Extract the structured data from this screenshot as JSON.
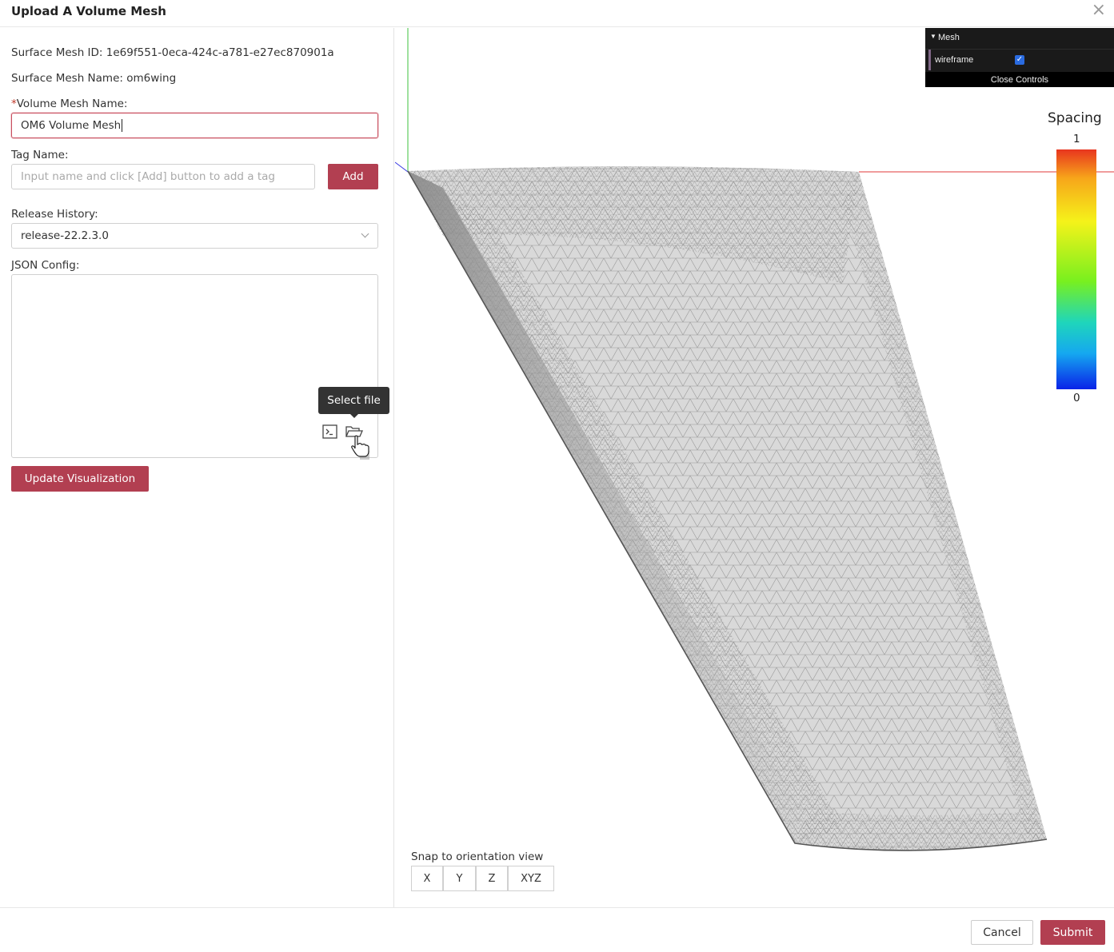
{
  "dialog": {
    "title": "Upload A Volume Mesh",
    "close_icon": "×"
  },
  "form": {
    "surface_mesh_id_label": "Surface Mesh ID:",
    "surface_mesh_id": "1e69f551-0eca-424c-a781-e27ec870901a",
    "surface_mesh_name_label": "Surface Mesh Name:",
    "surface_mesh_name": "om6wing",
    "required_mark": "*",
    "volume_mesh_name_label": "Volume Mesh Name:",
    "volume_mesh_name_value": "OM6 Volume Mesh",
    "tag_name_label": "Tag Name:",
    "tag_placeholder": "Input name and click [Add] button to add a tag",
    "add_button": "Add",
    "release_history_label": "Release History:",
    "release_history_value": "release-22.2.3.0",
    "json_config_label": "JSON Config:",
    "json_config_value": "",
    "select_file_tooltip": "Select file",
    "update_button": "Update Visualization"
  },
  "viewer": {
    "gui": {
      "folder": "Mesh",
      "wireframe_label": "wireframe",
      "wireframe_checked": true,
      "close_controls": "Close Controls"
    },
    "legend": {
      "title": "Spacing",
      "max": "1",
      "min": "0"
    },
    "snap": {
      "label": "Snap to orientation view",
      "buttons": [
        "X",
        "Y",
        "Z",
        "XYZ"
      ]
    }
  },
  "footer": {
    "cancel": "Cancel",
    "submit": "Submit"
  },
  "colors": {
    "accent": "#b23f51",
    "mesh": "#bdbdbd"
  }
}
